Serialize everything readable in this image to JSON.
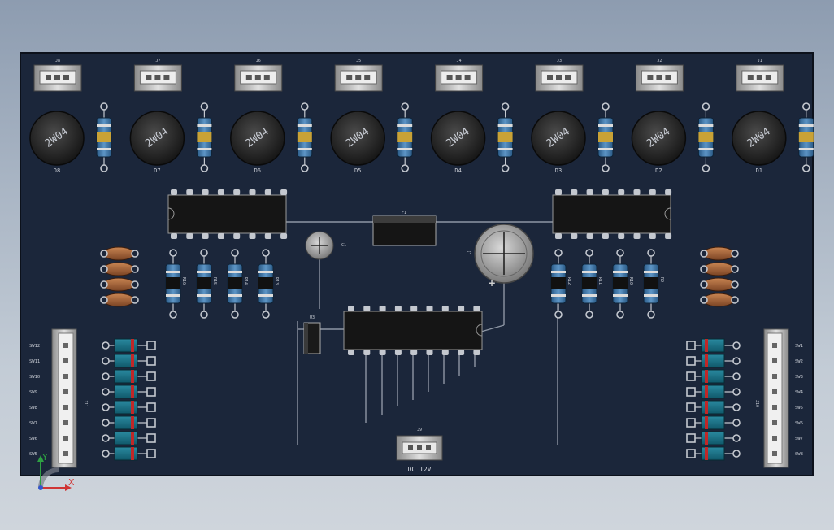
{
  "title": "",
  "connectors_top": [
    "J8",
    "J7",
    "J6",
    "J5",
    "J4",
    "J3",
    "J2",
    "J1"
  ],
  "diodes": [
    "D8",
    "D7",
    "D6",
    "D5",
    "D4",
    "D3",
    "D2",
    "D1"
  ],
  "diode_marking": "2W04",
  "power_connector": {
    "ref": "J9",
    "caption": "DC 12V"
  },
  "regulator": "U3",
  "capacitor_large": "C2",
  "capacitor_small": "C1",
  "fuse": "F1",
  "left_header": {
    "ref": "J11",
    "pins": [
      "SW12",
      "SW11",
      "SW10",
      "SW9",
      "SW8",
      "SW7",
      "SW6",
      "SW5"
    ]
  },
  "right_header": {
    "ref": "J10",
    "pins": [
      "SW1",
      "SW2",
      "SW3",
      "SW4",
      "SW5",
      "SW6",
      "SW7",
      "SW8"
    ]
  },
  "resistors_left": [
    "R16",
    "R15",
    "R14",
    "R13"
  ],
  "resistors_right": [
    "R12",
    "R11",
    "R10",
    "R9"
  ],
  "axes": {
    "y": "Y",
    "x": "X"
  },
  "colors": {
    "board": "#1b263a",
    "copper": "#c4c8cf",
    "chip": "#151515"
  }
}
